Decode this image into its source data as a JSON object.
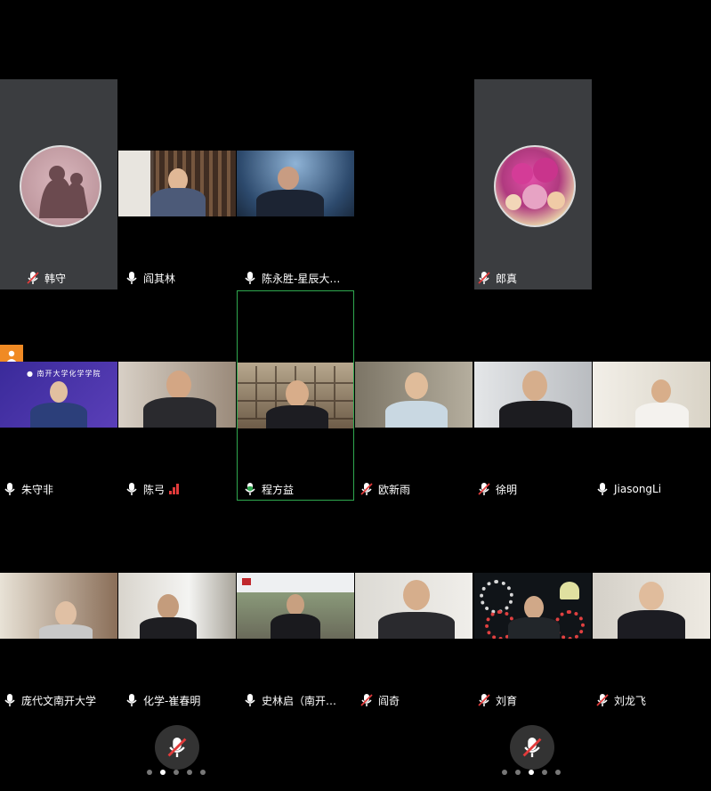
{
  "participants": [
    {
      "name": "韩守",
      "mic": "muted"
    },
    {
      "name": "阎其林",
      "mic": "on"
    },
    {
      "name": "陈永胜-星辰大…",
      "mic": "on"
    },
    {
      "name": "郎真",
      "mic": "muted"
    },
    {
      "name": "朱守非",
      "mic": "on"
    },
    {
      "name": "陈弓",
      "mic": "on"
    },
    {
      "name": "程方益",
      "mic": "speaking"
    },
    {
      "name": "欧新雨",
      "mic": "muted"
    },
    {
      "name": "徐明",
      "mic": "muted"
    },
    {
      "name": "JiasongLi",
      "mic": "on"
    },
    {
      "name": "庞代文南开大学",
      "mic": "on"
    },
    {
      "name": "化学-崔春明",
      "mic": "on"
    },
    {
      "name": "史林启（南开…",
      "mic": "on"
    },
    {
      "name": "阎奇",
      "mic": "muted"
    },
    {
      "name": "刘育",
      "mic": "muted"
    },
    {
      "name": "刘龙飞",
      "mic": "muted"
    }
  ],
  "colors": {
    "speaking_border": "#2fa84f",
    "muted_slash": "#e23b3b",
    "avatar_tile": "#3b3d40"
  },
  "pages": {
    "left_active": 2,
    "right_active": 3,
    "count": 5
  }
}
